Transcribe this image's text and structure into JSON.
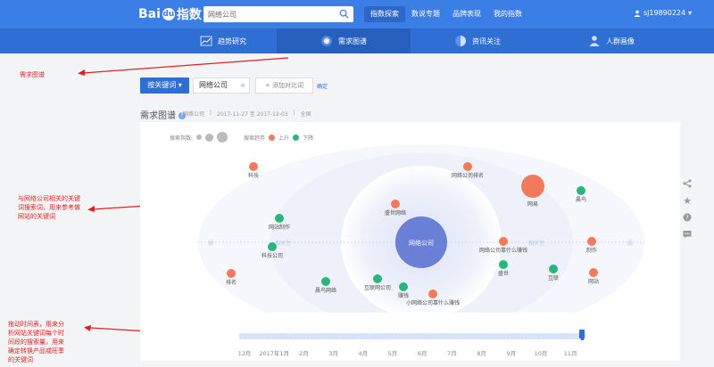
{
  "topbar": {
    "logo_text": "Bai",
    "logo_paw": "du",
    "logo_suffix": "指数",
    "search_value": "网络公司",
    "nav": [
      "指数探索",
      "数说专题",
      "品牌表现",
      "我的指数"
    ],
    "username": "sj19890224"
  },
  "subnav": {
    "tabs": [
      {
        "label": "趋势研究",
        "icon": "trend-chart-icon"
      },
      {
        "label": "需求图谱",
        "icon": "target-icon"
      },
      {
        "label": "资讯关注",
        "icon": "news-icon"
      },
      {
        "label": "人群画像",
        "icon": "people-icon"
      }
    ],
    "active": "需求图谱"
  },
  "annotations": {
    "note1": "需求图谱",
    "note2": [
      "与网络公司相关的关键",
      "词搜索词，用来参考做",
      "网站的关键词"
    ],
    "note3": [
      "拖动时间表，用来分",
      "析网站关键词每个时",
      "间段的搜索量，用来",
      "确定转换产品或旺季",
      "的关键词"
    ]
  },
  "toolbar": {
    "keyword_button": "按关键词",
    "keyword_chip": "网络公司",
    "add_compare": "+ 添加对比词",
    "confirm": "确定"
  },
  "section": {
    "title": "需求图谱",
    "keyword": "网络公司",
    "date_range": "2017-11-27 至 2017-12-03",
    "region": "全国"
  },
  "legend": {
    "search_index": "搜索指数:",
    "search_trend": "搜索趋势",
    "up": "上升",
    "down": "下降"
  },
  "colors": {
    "up": "#f07a5c",
    "down": "#2cb57a",
    "center": "#6a7fd6",
    "brand": "#3b7ee6"
  },
  "graph": {
    "center": "网络公司",
    "axis_left": "相关性",
    "axis_right": "相关性",
    "axis_left_far": "弱",
    "axis_right_far": "弱",
    "nodes": [
      {
        "label": "科技",
        "trend": "up"
      },
      {
        "label": "网络公司排名",
        "trend": "up"
      },
      {
        "label": "网易",
        "trend": "up"
      },
      {
        "label": "晨鸟",
        "trend": "down"
      },
      {
        "label": "盛世网络",
        "trend": "up"
      },
      {
        "label": "网站制作",
        "trend": "down"
      },
      {
        "label": "科技公司",
        "trend": "down"
      },
      {
        "label": "网络公司靠什么赚钱",
        "trend": "up"
      },
      {
        "label": "制作",
        "trend": "up"
      },
      {
        "label": "盛世",
        "trend": "down"
      },
      {
        "label": "互联",
        "trend": "down"
      },
      {
        "label": "排名",
        "trend": "up"
      },
      {
        "label": "晨鸟网络",
        "trend": "down"
      },
      {
        "label": "互联网公司",
        "trend": "down"
      },
      {
        "label": "赚钱",
        "trend": "down"
      },
      {
        "label": "小网络公司靠什么赚钱",
        "trend": "up"
      },
      {
        "label": "网站",
        "trend": "up"
      }
    ]
  },
  "timeline": {
    "labels": [
      "12月",
      "2017年1月",
      "2月",
      "3月",
      "4月",
      "5月",
      "6月",
      "7月",
      "8月",
      "9月",
      "10月",
      "11月"
    ]
  },
  "side_icons": [
    "share-icon",
    "star-icon",
    "help-icon",
    "comment-icon"
  ]
}
